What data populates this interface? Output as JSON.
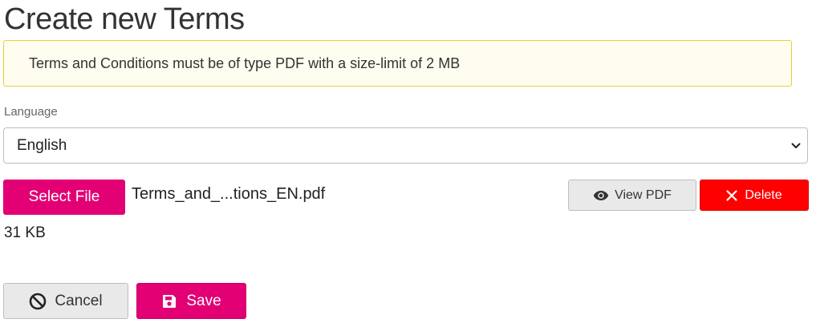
{
  "page": {
    "title": "Create new Terms"
  },
  "notice": {
    "text": "Terms and Conditions must be of type PDF with a size-limit of 2 MB"
  },
  "language": {
    "label": "Language",
    "selected": "English",
    "icon": "chevron-down-icon"
  },
  "file": {
    "select_label": "Select File",
    "name": "Terms_and_...tions_EN.pdf",
    "size": "31 KB",
    "view_label": "View PDF",
    "view_icon": "eye-icon",
    "delete_label": "Delete",
    "delete_icon": "close-icon"
  },
  "actions": {
    "cancel_label": "Cancel",
    "cancel_icon": "ban-icon",
    "save_label": "Save",
    "save_icon": "floppy-disk-icon"
  },
  "colors": {
    "brand": "#e20074",
    "danger": "#ff0000",
    "notice_border": "#e6cf3a",
    "notice_background": "#fffdf0"
  }
}
